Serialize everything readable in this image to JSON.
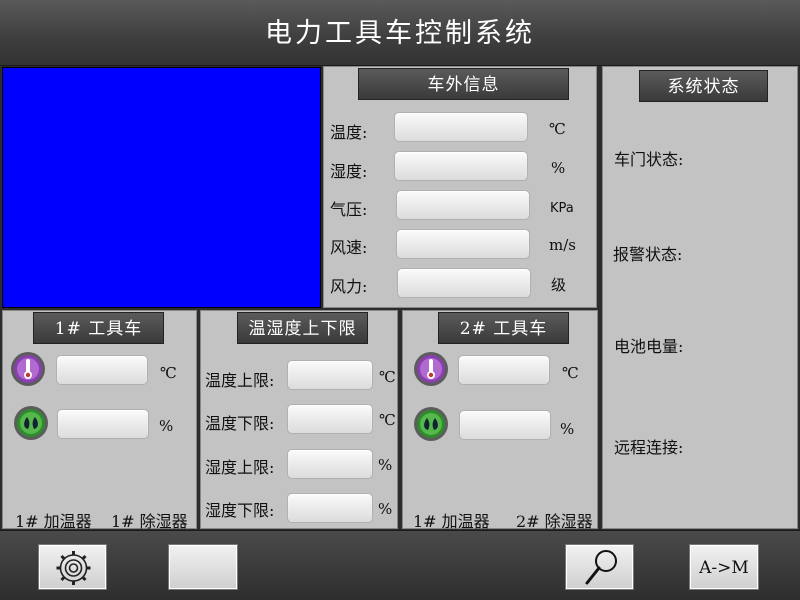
{
  "title": "电力工具车控制系统",
  "outside": {
    "header": "车外信息",
    "rows": [
      {
        "label": "温度:",
        "value": "",
        "unit": "℃"
      },
      {
        "label": "湿度:",
        "value": "",
        "unit": "%"
      },
      {
        "label": "气压:",
        "value": "",
        "unit": "KPa"
      },
      {
        "label": "风速:",
        "value": "",
        "unit": "m/s"
      },
      {
        "label": "风力:",
        "value": "",
        "unit": "级"
      }
    ]
  },
  "status": {
    "header": "系统状态",
    "items": [
      {
        "label": "车门状态:"
      },
      {
        "label": "报警状态:"
      },
      {
        "label": "电池电量:"
      },
      {
        "label": "远程连接:"
      }
    ]
  },
  "car1": {
    "header": "1# 工具车",
    "temp_unit": "℃",
    "hum_unit": "%",
    "heater": "1# 加温器",
    "dehum": "1# 除湿器"
  },
  "limits": {
    "header": "温湿度上下限",
    "rows": [
      {
        "label": "温度上限:",
        "unit": "℃"
      },
      {
        "label": "温度下限:",
        "unit": "℃"
      },
      {
        "label": "湿度上限:",
        "unit": "%"
      },
      {
        "label": "湿度下限:",
        "unit": "%"
      }
    ]
  },
  "car2": {
    "header": "2# 工具车",
    "temp_unit": "℃",
    "hum_unit": "%",
    "heater": "1# 加温器",
    "dehum": "2# 除湿器"
  },
  "toolbar": {
    "mode_label": "A->M"
  },
  "colors": {
    "video": "#0000ff",
    "thermo_icon": "#7a3a9a",
    "humidity_icon": "#2e8b2e"
  },
  "icons": {
    "settings": "gear-icon",
    "search": "magnifier-icon",
    "temperature": "thermometer-icon",
    "humidity": "droplet-icon"
  }
}
